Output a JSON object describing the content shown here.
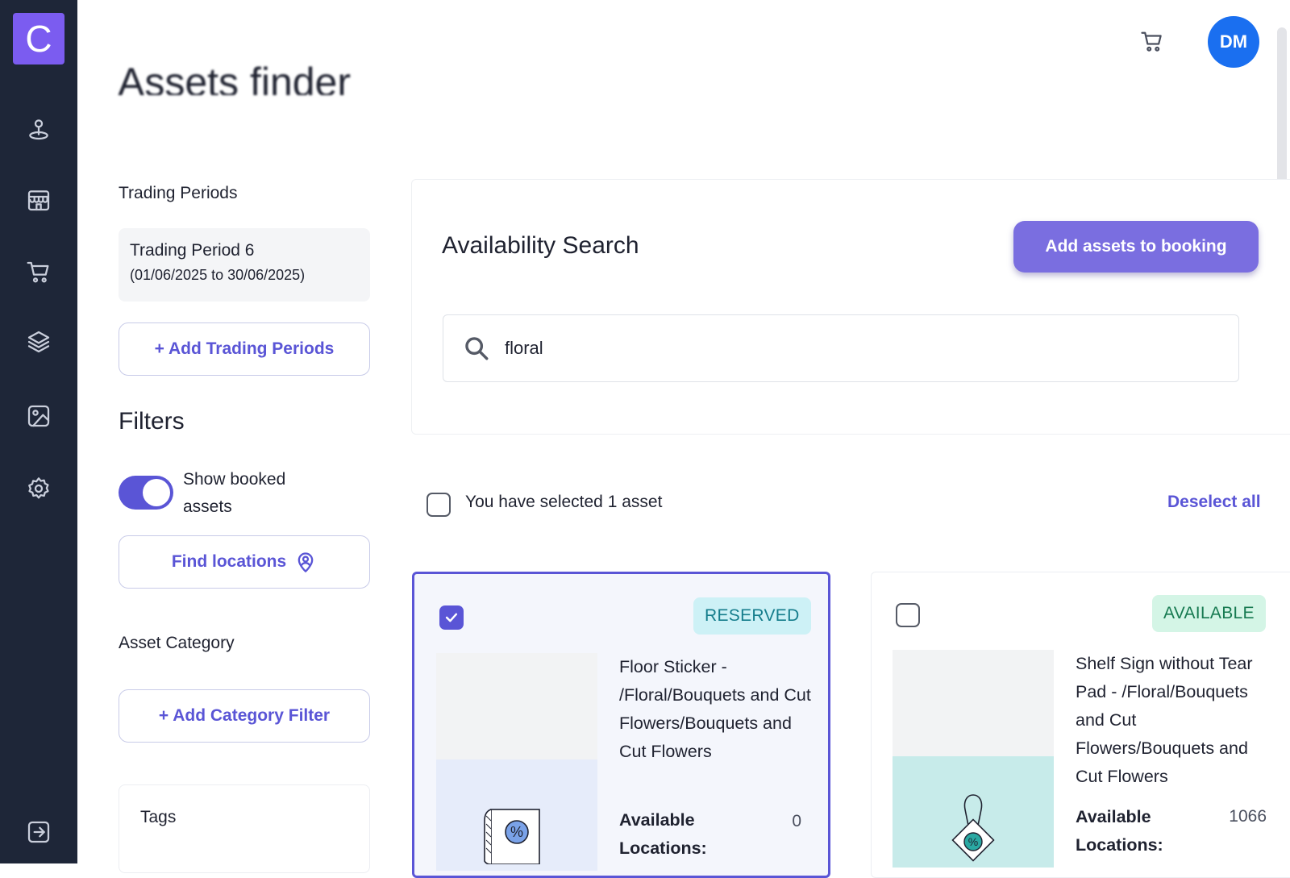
{
  "app": {
    "logo_letter": "C",
    "brand_color": "#7b5cf0",
    "accent_color": "#5a55d6",
    "sidebar_color": "#1e2638"
  },
  "sidebar": {
    "items": [
      {
        "icon": "location-pin-icon"
      },
      {
        "icon": "store-icon"
      },
      {
        "icon": "cart-icon"
      },
      {
        "icon": "layers-icon"
      },
      {
        "icon": "image-icon"
      },
      {
        "icon": "gear-icon"
      }
    ],
    "logout_icon": "logout-icon"
  },
  "header": {
    "page_title": "Assets finder",
    "cart_icon": "cart-icon",
    "avatar_initials": "DM"
  },
  "filters_panel": {
    "trading_periods_label": "Trading Periods",
    "period_name": "Trading Period 6",
    "period_range": "(01/06/2025 to 30/06/2025)",
    "add_trading_periods_label": "+ Add Trading Periods",
    "filters_heading": "Filters",
    "show_booked_label": "Show booked assets",
    "show_booked_on": true,
    "find_locations_label": "Find locations",
    "asset_category_label": "Asset Category",
    "add_category_label": "+ Add Category Filter",
    "tags_label": "Tags"
  },
  "search": {
    "heading": "Availability Search",
    "add_to_booking_label": "Add assets to booking",
    "query": "floral"
  },
  "selection": {
    "summary": "You have selected 1 asset",
    "deselect_label": "Deselect all"
  },
  "assets": [
    {
      "selected": true,
      "status": "RESERVED",
      "title": "Floor Sticker - /Floral/Bouquets and Cut Flowers/Bouquets and Cut Flowers",
      "available_label": "Available Locations:",
      "available_count": "0"
    },
    {
      "selected": false,
      "status": "AVAILABLE",
      "title": "Shelf Sign without Tear Pad - /Floral/Bouquets and Cut Flowers/Bouquets and Cut Flowers",
      "available_label": "Available Locations:",
      "available_count": "1066"
    }
  ]
}
